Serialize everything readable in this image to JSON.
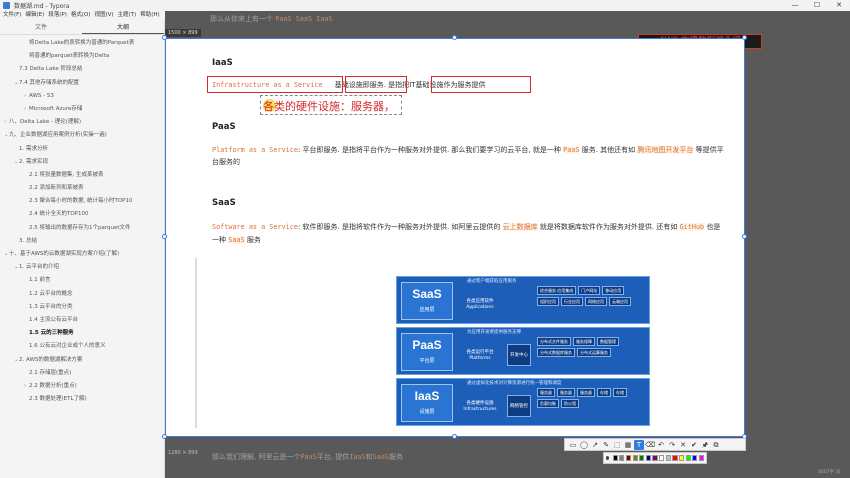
{
  "window": {
    "title": "数据湖.md - Typora",
    "controls": [
      "—",
      "☐",
      "✕"
    ]
  },
  "menu": [
    "文件(F)",
    "编辑(E)",
    "段落(P)",
    "格式(O)",
    "视图(V)",
    "主题(T)",
    "帮助(H)"
  ],
  "sidebar": {
    "tabs": [
      "文件",
      "大纲"
    ],
    "active_tab": 1,
    "toc": [
      {
        "level": 2,
        "text": "将Delta Lake的表转换为普通的Parquet表",
        "arrow": ""
      },
      {
        "level": 2,
        "text": "将普通的parquet表转换为Delta",
        "arrow": ""
      },
      {
        "level": 1,
        "text": "7.3 Delta Lake 阶段总结",
        "arrow": ""
      },
      {
        "level": 1,
        "text": "7.4 其他存储系统的配置",
        "arrow": "⌄"
      },
      {
        "level": 2,
        "text": "AWS - S3",
        "arrow": "›"
      },
      {
        "level": 2,
        "text": "Microsoft Azure存储",
        "arrow": "›"
      },
      {
        "level": 0,
        "text": "八、Delta Lake - 理论(理解)",
        "arrow": "›"
      },
      {
        "level": 0,
        "text": "九、企业数据湖应用案例分析(实操一遍)",
        "arrow": "⌄"
      },
      {
        "level": 1,
        "text": "1. 需求分析",
        "arrow": ""
      },
      {
        "level": 1,
        "text": "2. 需求实现",
        "arrow": "⌄"
      },
      {
        "level": 2,
        "text": "2.1 将张量数据集, 生成某被表",
        "arrow": ""
      },
      {
        "level": 2,
        "text": "2.2 添加新列和某被表",
        "arrow": ""
      },
      {
        "level": 2,
        "text": "2.3 聚合每小时的数据, 统计每小时TOP10",
        "arrow": ""
      },
      {
        "level": 2,
        "text": "2.4 统计全天的TOP100",
        "arrow": ""
      },
      {
        "level": 2,
        "text": "2.5 将输出的数据存存为1个parquet文件",
        "arrow": ""
      },
      {
        "level": 1,
        "text": "3. 总结",
        "arrow": ""
      },
      {
        "level": 0,
        "text": "十、基于AWS的云数据湖实现方案介绍(了解)",
        "arrow": "⌄"
      },
      {
        "level": 1,
        "text": "1. 云平台的介绍",
        "arrow": "⌄"
      },
      {
        "level": 2,
        "text": "1.1 前言",
        "arrow": ""
      },
      {
        "level": 2,
        "text": "1.2 云平台的概念",
        "arrow": ""
      },
      {
        "level": 2,
        "text": "1.3 云平台的分类",
        "arrow": ""
      },
      {
        "level": 2,
        "text": "1.4 主流公有云平台",
        "arrow": ""
      },
      {
        "level": 2,
        "text": "1.5 云的三种服务",
        "arrow": "",
        "active": true
      },
      {
        "level": 2,
        "text": "1.6 公有云对企业或个人的意义",
        "arrow": ""
      },
      {
        "level": 1,
        "text": "2. AWS的数据湖解决方案",
        "arrow": "⌄"
      },
      {
        "level": 2,
        "text": "2.1 存储层(重点)",
        "arrow": ""
      },
      {
        "level": 2,
        "text": "2.2 数据分析(重点)",
        "arrow": "›"
      },
      {
        "level": 2,
        "text": "2.3 数据处理(ETL了解)",
        "arrow": ""
      }
    ]
  },
  "editor": {
    "top_peek": {
      "pre": "那么从你来上有一个",
      "code": "PaaS SaaS IaaS"
    },
    "bottom_peek": {
      "pre": "那么我们理解, 阿里云是一个",
      "code1": "PaaS",
      "mid": "平台, 提供",
      "code2": "IaaS",
      "mid2": "和",
      "code3": "SaaS",
      "post": "服务"
    },
    "corner_stamp": "4007字 词"
  },
  "banner": {
    "text": "AWS 构建数据湖介绍"
  },
  "capture": {
    "size_label": "1500 × 899",
    "size_label_bottom": "1280 × 899"
  },
  "doc": {
    "iaas_heading": "IaaS",
    "iaas_code": "Infrastructure as a Service",
    "iaas_mid": "基础设施即服务",
    "iaas_mid2": ". 是指把",
    "iaas_tail": "IT基础设施作为服务提供",
    "annotation": "各类的硬件设施：服务器，",
    "paas_heading": "PaaS",
    "paas_code": "Platform as a Service",
    "paas_text1": ": 平台即服务. 是指将平台作为一种服务对外提供. 那么我们要学习的云平台, 就是一种",
    "paas_hl": "PaaS",
    "paas_text2": "服务. 其他还有如",
    "paas_hl2": "腾讯地图开发平台",
    "paas_text3": "等提供平",
    "paas_text4": "台服务的",
    "saas_heading": "SaaS",
    "saas_code": "Software as a Service",
    "saas_text1": ": 软件即服务. 是指将软件作为一种服务对外提供. 如阿里云提供的",
    "saas_hl": "云上数据库",
    "saas_text2": "就是将数据库软件作为服务对外提供. 还有如",
    "saas_hl2": "GitHub",
    "saas_text3": "也是",
    "saas_text4": "一种",
    "saas_hl3": "SaaS",
    "saas_text5": "服务"
  },
  "stack": {
    "layers": [
      {
        "abbr": "SaaS",
        "cn": "应用层",
        "cap": "通过客户端获取应用服务",
        "eng": "各类应用软件 Applications",
        "core": "",
        "cells": [
          "综合服务 应用集成",
          "门户网站",
          "移动应用",
          "组织应用",
          "行业应用",
          "网络应用",
          "云端应用"
        ]
      },
      {
        "abbr": "PaaS",
        "cn": "平台层",
        "cap": "为应用开发者提供服务支撑",
        "eng": "各类运行平台 Platforms",
        "core": "开发中心",
        "cells": [
          "分布式文件服务",
          "服务保障",
          "数据管理",
          "分布式数据库服务",
          "分布式运算服务"
        ]
      },
      {
        "abbr": "IaaS",
        "cn": "设施层",
        "cap": "通过虚拟化技术对计算资源进行统一管理和调度",
        "eng": "各类硬件设施 Infrastructures",
        "core": "网络管控",
        "cells": [
          "服务器",
          "服务器",
          "服务器",
          "存储",
          "存储",
          "负载均衡",
          "防火墙"
        ]
      }
    ]
  },
  "toolbar": {
    "tools": [
      "▭",
      "◯",
      "↗",
      "✎",
      "⬚",
      "▦",
      "T",
      "⌫",
      "↶",
      "↷",
      "✕",
      "✔",
      "🖈",
      "⧉"
    ],
    "selected": 6
  },
  "palette": {
    "colors": [
      "#000000",
      "#808080",
      "#800000",
      "#808000",
      "#008000",
      "#000080",
      "#800080",
      "#ffffff",
      "#c0c0c0",
      "#ff0000",
      "#ffff00",
      "#00ff00",
      "#0000ff",
      "#ff00ff"
    ]
  }
}
